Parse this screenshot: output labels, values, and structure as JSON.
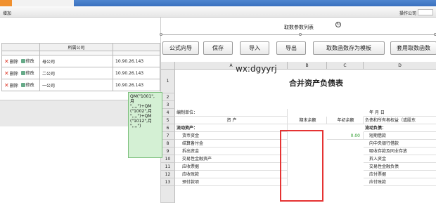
{
  "toolbar": {
    "add_label": "增加",
    "ops_label": "操作公司"
  },
  "left": {
    "header": {
      "company_col": "所属公司"
    },
    "rows": [
      {
        "delete": "删除",
        "edit": "修改",
        "company": "母公司",
        "ip": "10.90.26.143"
      },
      {
        "delete": "删除",
        "edit": "修改",
        "company": "二公司",
        "ip": "10.90.26.143"
      },
      {
        "delete": "删除",
        "edit": "修改",
        "company": "一公司",
        "ip": "10.90.26.143"
      }
    ]
  },
  "right": {
    "title": "取数参数列表",
    "buttons": [
      "公式向导",
      "保存",
      "导入",
      "导出",
      "取数函数存为模板",
      "套用取数函数"
    ],
    "watermark": "wx:dgyyrj",
    "columns": [
      "A",
      "B",
      "C",
      "D"
    ],
    "rows": [
      {
        "n": "1",
        "a": "合并资产负债表"
      },
      {
        "n": "2"
      },
      {
        "n": "3"
      },
      {
        "n": "4",
        "a": "编制单位：",
        "d": "年  月  日"
      },
      {
        "n": "5",
        "a": "资        产",
        "b": "期末余额",
        "c": "年初余额",
        "d": "负债和所有者权益（或股东"
      },
      {
        "n": "6",
        "a": "流动资产：",
        "d": "流动负债："
      },
      {
        "n": "7",
        "a": "货币资金",
        "c": "0.00",
        "d": "短期借款"
      },
      {
        "n": "8",
        "a": "结算备付金",
        "d": "向中央银行借款"
      },
      {
        "n": "9",
        "a": "拆出资金",
        "d": "吸收存款及同业存放"
      },
      {
        "n": "10",
        "a": "交易性金融资产",
        "d": "拆入资金"
      },
      {
        "n": "11",
        "a": "应收票据",
        "d": "交易性金融负债"
      },
      {
        "n": "12",
        "a": "应收账款",
        "d": "应付票据"
      },
      {
        "n": "13",
        "a": "预付款项",
        "d": "应付账款"
      }
    ],
    "formulas": [
      "QM(\"1001\",",
      "月",
      "\",,,,\")+QM",
      "(\"1002\",月",
      "\",,,,\")+QM",
      "(\"1012\",月",
      "\",,,,\")"
    ]
  },
  "colors": {
    "accent": "#3b71bf",
    "tab_orange": "#f0902e",
    "formula_bg": "#d4f0d4",
    "highlight": "#e53333"
  }
}
